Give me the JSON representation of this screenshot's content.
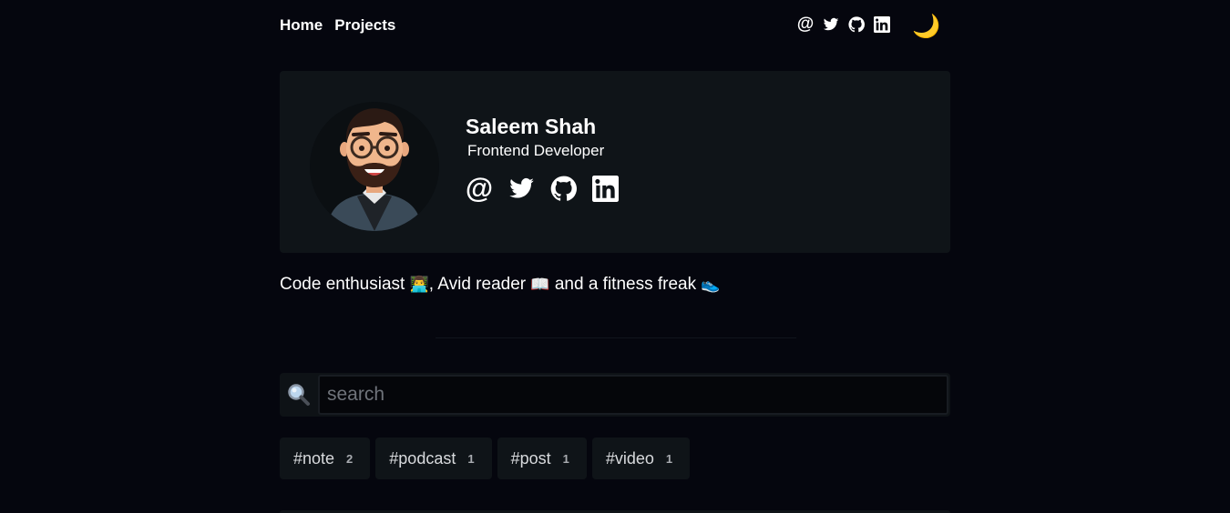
{
  "nav": {
    "links": [
      "Home",
      "Projects"
    ],
    "social": {
      "email": "@"
    },
    "theme_icon": "🌙"
  },
  "profile": {
    "name": "Saleem Shah",
    "role": "Frontend Developer",
    "social": {
      "email": "@"
    }
  },
  "bio": {
    "part1": "Code enthusiast",
    "emoji1": "👨‍💻",
    "part2": ", Avid reader",
    "emoji2": "📖",
    "part3": "and a fitness freak",
    "emoji3": "👟"
  },
  "search": {
    "placeholder": "search",
    "icon": "🔍"
  },
  "tags": [
    {
      "name": "#note",
      "count": "2"
    },
    {
      "name": "#podcast",
      "count": "1"
    },
    {
      "name": "#post",
      "count": "1"
    },
    {
      "name": "#video",
      "count": "1"
    }
  ]
}
